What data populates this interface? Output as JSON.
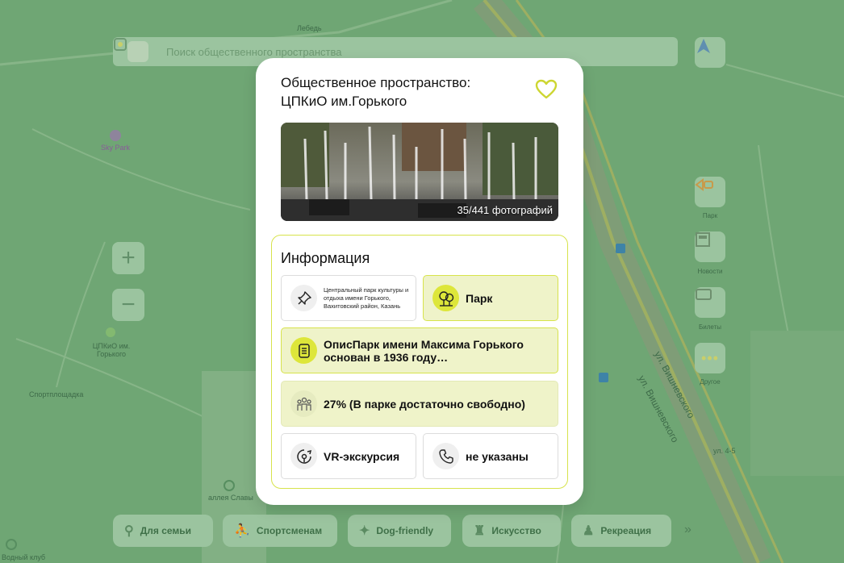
{
  "search": {
    "placeholder": "Поиск общественного пространства"
  },
  "map": {
    "labels": [
      "Лебедь",
      "Sky Park",
      "ЦПКиО им. Горького",
      "Спортплощадка",
      "аллея Славы",
      "ул. Вишневского",
      "ул. Вишневского",
      "ул. 4-5",
      "Водный клуб"
    ],
    "side_buttons": [
      "Парк",
      "Новости",
      "Билеты",
      "Другое"
    ]
  },
  "modal": {
    "title_line1": "Общественное пространство:",
    "title_line2": "ЦПКиО им.Горького",
    "photo_count": "35/441 фотографий",
    "info_title": "Информация",
    "address": "Центральный парк культуры и отдыха имени Горького, Вахитовский район, Казань",
    "type": "Парк",
    "description": "ОписПарк имени Максима Горького основан в 1936 году…",
    "occupancy": "27% (В парке достаточно свободно)",
    "vr": "VR-экскурсия",
    "phone": "не указаны"
  },
  "categories": [
    "Для семьи",
    "Спортсменам",
    "Dog-friendly",
    "Искусство",
    "Рекреация"
  ],
  "colors": {
    "accent": "#d7e34b",
    "accent_fill": "#eff3c9",
    "icon_lime": "#dde63a",
    "map_green": "#7fb083"
  },
  "icons": [
    "search-logo-icon",
    "navigation-icon",
    "zoom-in-icon",
    "zoom-out-icon",
    "heart-icon",
    "pin-icon",
    "tree-icon",
    "document-icon",
    "people-icon",
    "vr-icon",
    "phone-icon"
  ]
}
